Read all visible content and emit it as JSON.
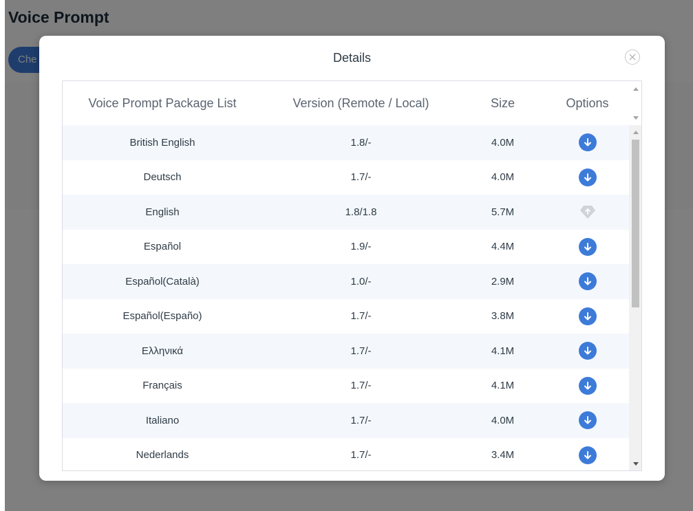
{
  "page": {
    "title": "Voice Prompt",
    "check_button_label": "Che"
  },
  "modal": {
    "title": "Details",
    "close_icon": "close-icon"
  },
  "table": {
    "columns": [
      "Voice Prompt Package List",
      "Version (Remote / Local)",
      "Size",
      "Options"
    ],
    "rows": [
      {
        "name": "British English",
        "version": "1.8/-",
        "size": "4.0M",
        "option": "download"
      },
      {
        "name": "Deutsch",
        "version": "1.7/-",
        "size": "4.0M",
        "option": "download"
      },
      {
        "name": "English",
        "version": "1.8/1.8",
        "size": "5.7M",
        "option": "installed"
      },
      {
        "name": "Español",
        "version": "1.9/-",
        "size": "4.4M",
        "option": "download"
      },
      {
        "name": "Español(Català)",
        "version": "1.0/-",
        "size": "2.9M",
        "option": "download"
      },
      {
        "name": "Español(Españo)",
        "version": "1.7/-",
        "size": "3.8M",
        "option": "download"
      },
      {
        "name": "Ελληνικά",
        "version": "1.7/-",
        "size": "4.1M",
        "option": "download"
      },
      {
        "name": "Français",
        "version": "1.7/-",
        "size": "4.1M",
        "option": "download"
      },
      {
        "name": "Italiano",
        "version": "1.7/-",
        "size": "4.0M",
        "option": "download"
      },
      {
        "name": "Nederlands",
        "version": "1.7/-",
        "size": "3.4M",
        "option": "download"
      }
    ]
  },
  "colors": {
    "accent": "#3d7bd9",
    "row_alt": "#f4f8fc",
    "disabled_icon": "#d0d3d8"
  },
  "icons": {
    "download": "download-arrow-icon",
    "installed": "upgrade-disabled-icon"
  }
}
